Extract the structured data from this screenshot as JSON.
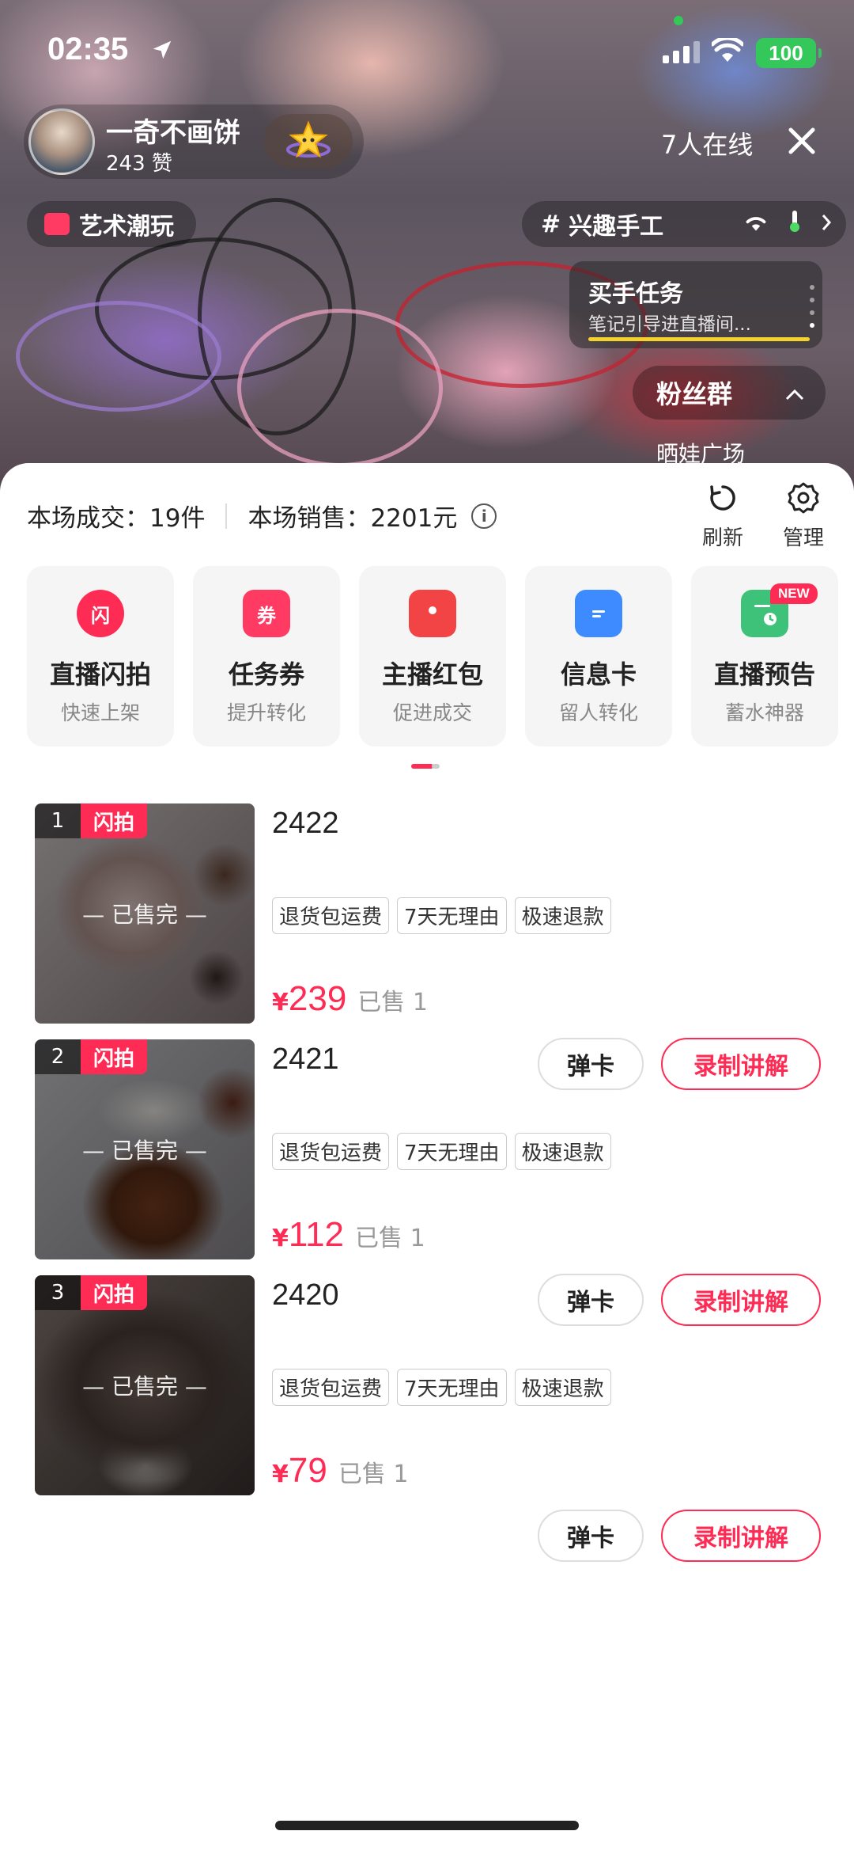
{
  "status_bar": {
    "time": "02:35",
    "battery": "100"
  },
  "live": {
    "host_name": "一奇不画饼",
    "host_likes": "243 赞",
    "online_count": "7人在线",
    "category_tag": "艺术潮玩",
    "interest_tag": "兴趣手工",
    "task_title": "买手任务",
    "task_subtitle": "笔记引导进直播间...",
    "fans_group": "粉丝群",
    "plaza": "晒娃广场"
  },
  "stats": {
    "deals": "本场成交：19件",
    "sales": "本场销售：2201元"
  },
  "tools": {
    "refresh": "刷新",
    "manage": "管理"
  },
  "features": [
    {
      "icon": "闪",
      "title": "直播闪拍",
      "subtitle": "快速上架",
      "color": "#fe2c55"
    },
    {
      "icon": "券",
      "title": "任务券",
      "subtitle": "提升转化",
      "color": "#ff3b64"
    },
    {
      "icon": "",
      "title": "主播红包",
      "subtitle": "促进成交",
      "color": "#f24444"
    },
    {
      "icon": "",
      "title": "信息卡",
      "subtitle": "留人转化",
      "color": "#3d8bff"
    },
    {
      "icon": "",
      "title": "直播预告",
      "subtitle": "蓄水神器",
      "color": "#3ec27a",
      "badge": "NEW"
    }
  ],
  "products": [
    {
      "rank": "1",
      "flash": "闪拍",
      "sold_out": "— 已售完 —",
      "title": "2422",
      "tags": [
        "退货包运费",
        "7天无理由",
        "极速退款"
      ],
      "currency": "¥",
      "price": "239",
      "sold": "已售 1",
      "card_btn": "弹卡",
      "record_btn": "录制讲解"
    },
    {
      "rank": "2",
      "flash": "闪拍",
      "sold_out": "— 已售完 —",
      "title": "2421",
      "tags": [
        "退货包运费",
        "7天无理由",
        "极速退款"
      ],
      "currency": "¥",
      "price": "112",
      "sold": "已售 1",
      "card_btn": "弹卡",
      "record_btn": "录制讲解"
    },
    {
      "rank": "3",
      "flash": "闪拍",
      "sold_out": "— 已售完 —",
      "title": "2420",
      "tags": [
        "退货包运费",
        "7天无理由",
        "极速退款"
      ],
      "currency": "¥",
      "price": "79",
      "sold": "已售 1",
      "card_btn": "弹卡",
      "record_btn": "录制讲解"
    }
  ],
  "colors": {
    "accent": "#fe2c55",
    "tag_border": "#cccccc"
  }
}
